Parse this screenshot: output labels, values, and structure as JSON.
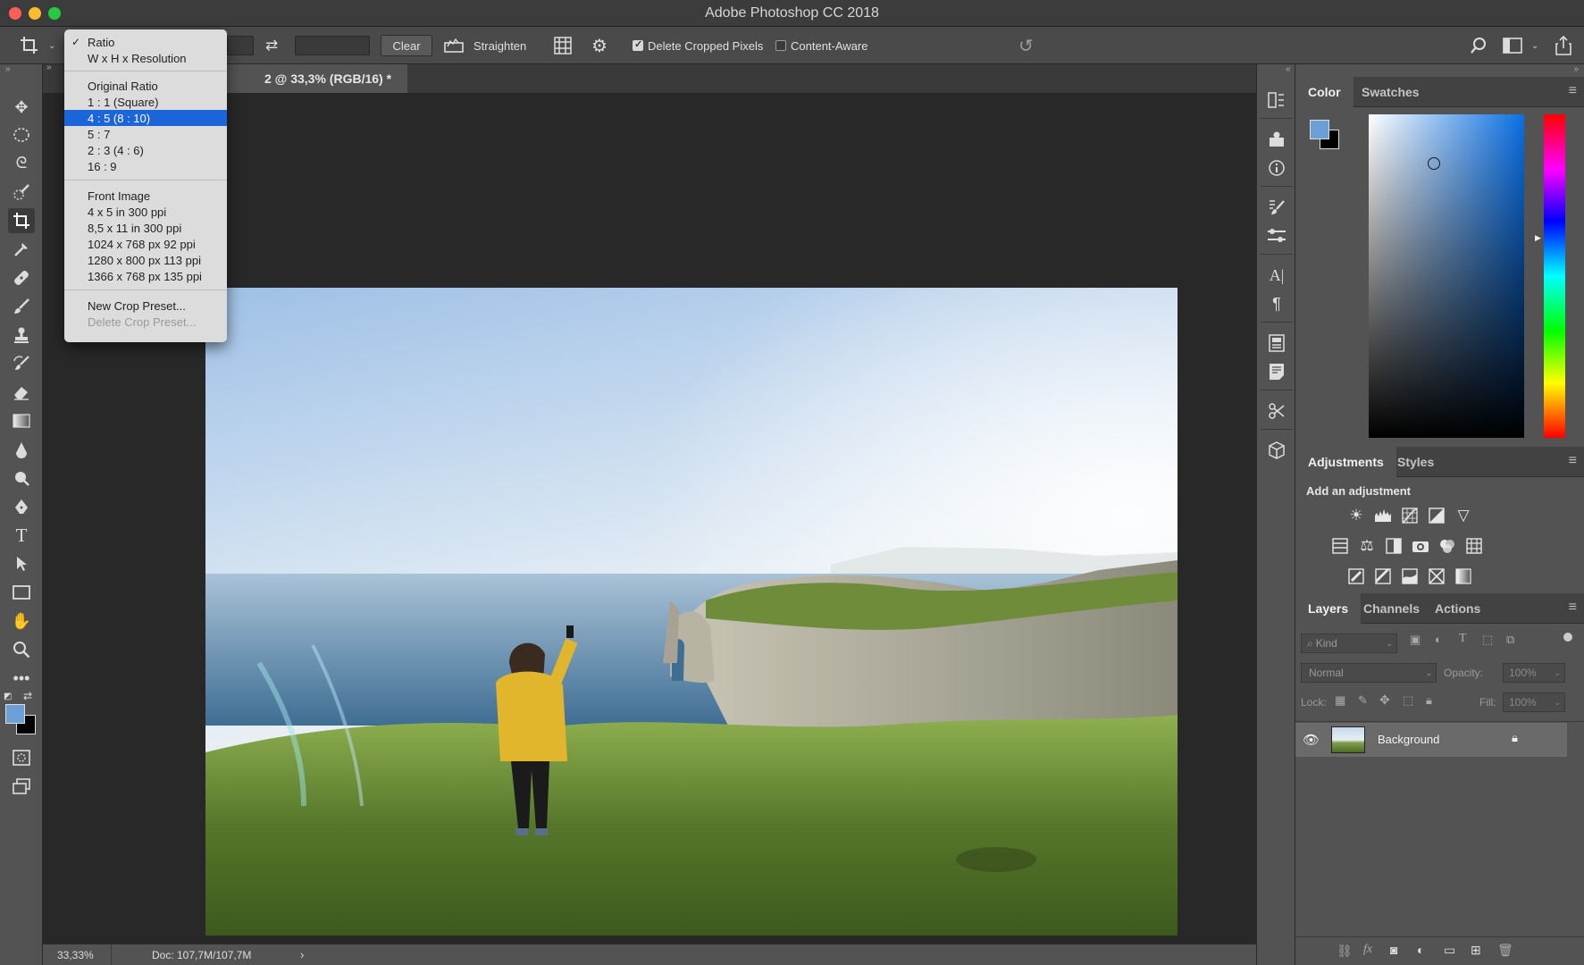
{
  "app": {
    "title": "Adobe Photoshop CC 2018"
  },
  "options_bar": {
    "clear_label": "Clear",
    "straighten_label": "Straighten",
    "delete_cropped_label": "Delete Cropped Pixels",
    "delete_cropped_checked": true,
    "content_aware_label": "Content-Aware",
    "content_aware_checked": false
  },
  "crop_menu": {
    "items": [
      {
        "label": "Ratio",
        "checked": true
      },
      {
        "label": "W x H x Resolution"
      },
      {
        "label": "Original Ratio"
      },
      {
        "label": "1 : 1 (Square)"
      },
      {
        "label": "4 : 5 (8 : 10)",
        "selected": true
      },
      {
        "label": "5 : 7"
      },
      {
        "label": "2 : 3 (4 : 6)"
      },
      {
        "label": "16 : 9"
      },
      {
        "label": "Front Image"
      },
      {
        "label": "4 x 5 in 300 ppi"
      },
      {
        "label": "8,5 x 11 in 300 ppi"
      },
      {
        "label": "1024 x 768 px 92 ppi"
      },
      {
        "label": "1280 x 800 px 113 ppi"
      },
      {
        "label": "1366 x 768 px 135 ppi"
      },
      {
        "label": "New Crop Preset..."
      },
      {
        "label": "Delete Crop Preset...",
        "disabled": true
      }
    ]
  },
  "document": {
    "tab_title": "2 @ 33,3% (RGB/16) *"
  },
  "status": {
    "zoom": "33,33%",
    "doc_size": "Doc: 107,7M/107,7M"
  },
  "color_panel": {
    "tabs": [
      "Color",
      "Swatches"
    ],
    "foreground_color": "#6a9fd8",
    "background_color": "#000000",
    "picker_hue_color": "#0a6fe3"
  },
  "adjustments_panel": {
    "tabs": [
      "Adjustments",
      "Styles"
    ],
    "heading": "Add an adjustment"
  },
  "layers_panel": {
    "tabs": [
      "Layers",
      "Channels",
      "Actions"
    ],
    "filter_kind": "Kind",
    "blend_mode": "Normal",
    "opacity_label": "Opacity:",
    "opacity_value": "100%",
    "lock_label": "Lock:",
    "fill_label": "Fill:",
    "fill_value": "100%",
    "layers": [
      {
        "name": "Background",
        "visible": true,
        "locked": true
      }
    ]
  }
}
